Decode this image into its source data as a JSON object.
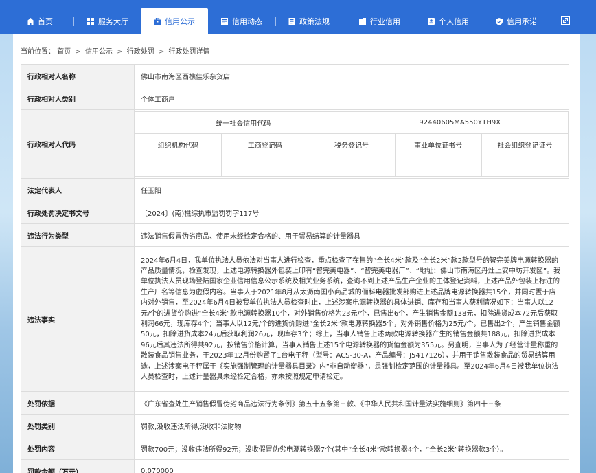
{
  "nav": {
    "items": [
      {
        "label": "首页",
        "icon": "home-icon",
        "active": false
      },
      {
        "label": "服务大厅",
        "icon": "grid-icon",
        "active": false
      },
      {
        "label": "信用公示",
        "icon": "briefcase-icon",
        "active": true
      },
      {
        "label": "信用动态",
        "icon": "news-icon",
        "active": false
      },
      {
        "label": "政策法规",
        "icon": "document-icon",
        "active": false
      },
      {
        "label": "行业信用",
        "icon": "building-icon",
        "active": false
      },
      {
        "label": "个人信用",
        "icon": "id-card-icon",
        "active": false
      },
      {
        "label": "信用承诺",
        "icon": "shield-check-icon",
        "active": false
      }
    ],
    "expand_icon": "expand-icon"
  },
  "breadcrumb": {
    "prefix": "当前位置：",
    "items": [
      "首页",
      "信用公示",
      "行政处罚",
      "行政处罚详情"
    ],
    "separator": ">"
  },
  "record": {
    "name_label": "行政相对人名称",
    "name_value": "佛山市南海区西樵佳乐杂货店",
    "category_label": "行政相对人类别",
    "category_value": "个体工商户",
    "code_label": "行政相对人代码",
    "uscc_label": "统一社会信用代码",
    "uscc_value": "92440605MA550Y1H9X",
    "sub_headers": [
      "组织机构代码",
      "工商登记码",
      "税务登记号",
      "事业单位证书号",
      "社会组织登记证号"
    ],
    "sub_values": [
      "",
      "",
      "",
      "",
      ""
    ],
    "legal_rep_label": "法定代表人",
    "legal_rep_value": "任玉阳",
    "doc_no_label": "行政处罚决定书文号",
    "doc_no_value": "〔2024〕(南)樵综执市监罚罚字117号",
    "violation_type_label": "违法行为类型",
    "violation_type_value": "违法销售假冒伪劣商品、使用未经检定合格的、用于贸易结算的计量器具",
    "facts_label": "违法事实",
    "facts_value": "2024年6月4日，我单位执法人员依法对当事人进行检查，重点检查了在售的“全长4米”款及“全长2米”款2款型号的智完美牌电源转换器的产品质量情况，检查发现，上述电源转换器外包装上印有“智完美电器”、“智完美电器厂”、“地址：佛山市南海区丹灶上安中坊开发区”。我单位执法人员现场登陆国家企业信用信息公示系统及相关业务系统，查询不到上述产品生产企业的主体登记资料，上述产品外包装上标注的生产厂名等信息为虚假内容。当事人于2021年8月从太沥南国小商品城的俪科电器批发部购进上述品牌电源转换器共15个，并同时置于店内对外销售，至2024年6月4日被我单位执法人员检查时止，上述涉案电源转换器的具体进销、库存和当事人获利情况如下：当事人以12元/个的进货价购进“全长4米”款电源转换器10个，对外销售价格为23元/个，已售出6个，产生销售金额138元，扣除进货成本72元后获取利润66元，现库存4个；当事人以12元/个的进货价购进“全长2米”款电源转换器5个，对外销售价格为25元/个，已售出2个，产生销售金额50元，扣除进货成本24元后获取利润26元，现库存3个；综上，当事人销售上述两款电源转换器产生的销售金额共188元，扣除进货成本96元后其违法所得共92元，按销售价格计算，当事人销售上述15个电源转换器的货值金额为355元。另查明，当事人为了经营计量称重的散装食品销售业务，于2023年12月份购置了1台电子秤（型号：ACS-30-A，产品编号：J5417126），并用于销售散装食品的贸易结算用途，上述涉案电子秤属于《实施强制管理的计量器具目录》内“非自动衡器”，是强制检定范围的计量器具。至2024年6月4日被我单位执法人员检查时，上述计量器具未经检定合格，亦未按照规定申请检定。",
    "basis_label": "处罚依据",
    "basis_value": "《广东省查处生产销售假冒伪劣商品违法行为条例》第五十五条第三款、《中华人民共和国计量法实施细则》第四十三条",
    "type_label": "处罚类别",
    "type_value": "罚款,没收违法所得,没收非法财物",
    "content_label": "处罚内容",
    "content_value": "罚款700元；没收违法所得92元；没收假冒伪劣电源转换器7个(其中“全长4米”款转换器4个，“全长2米”转换器款3个）。",
    "amount_label": "罚款金额（万元）",
    "amount_value": "0.070000"
  }
}
